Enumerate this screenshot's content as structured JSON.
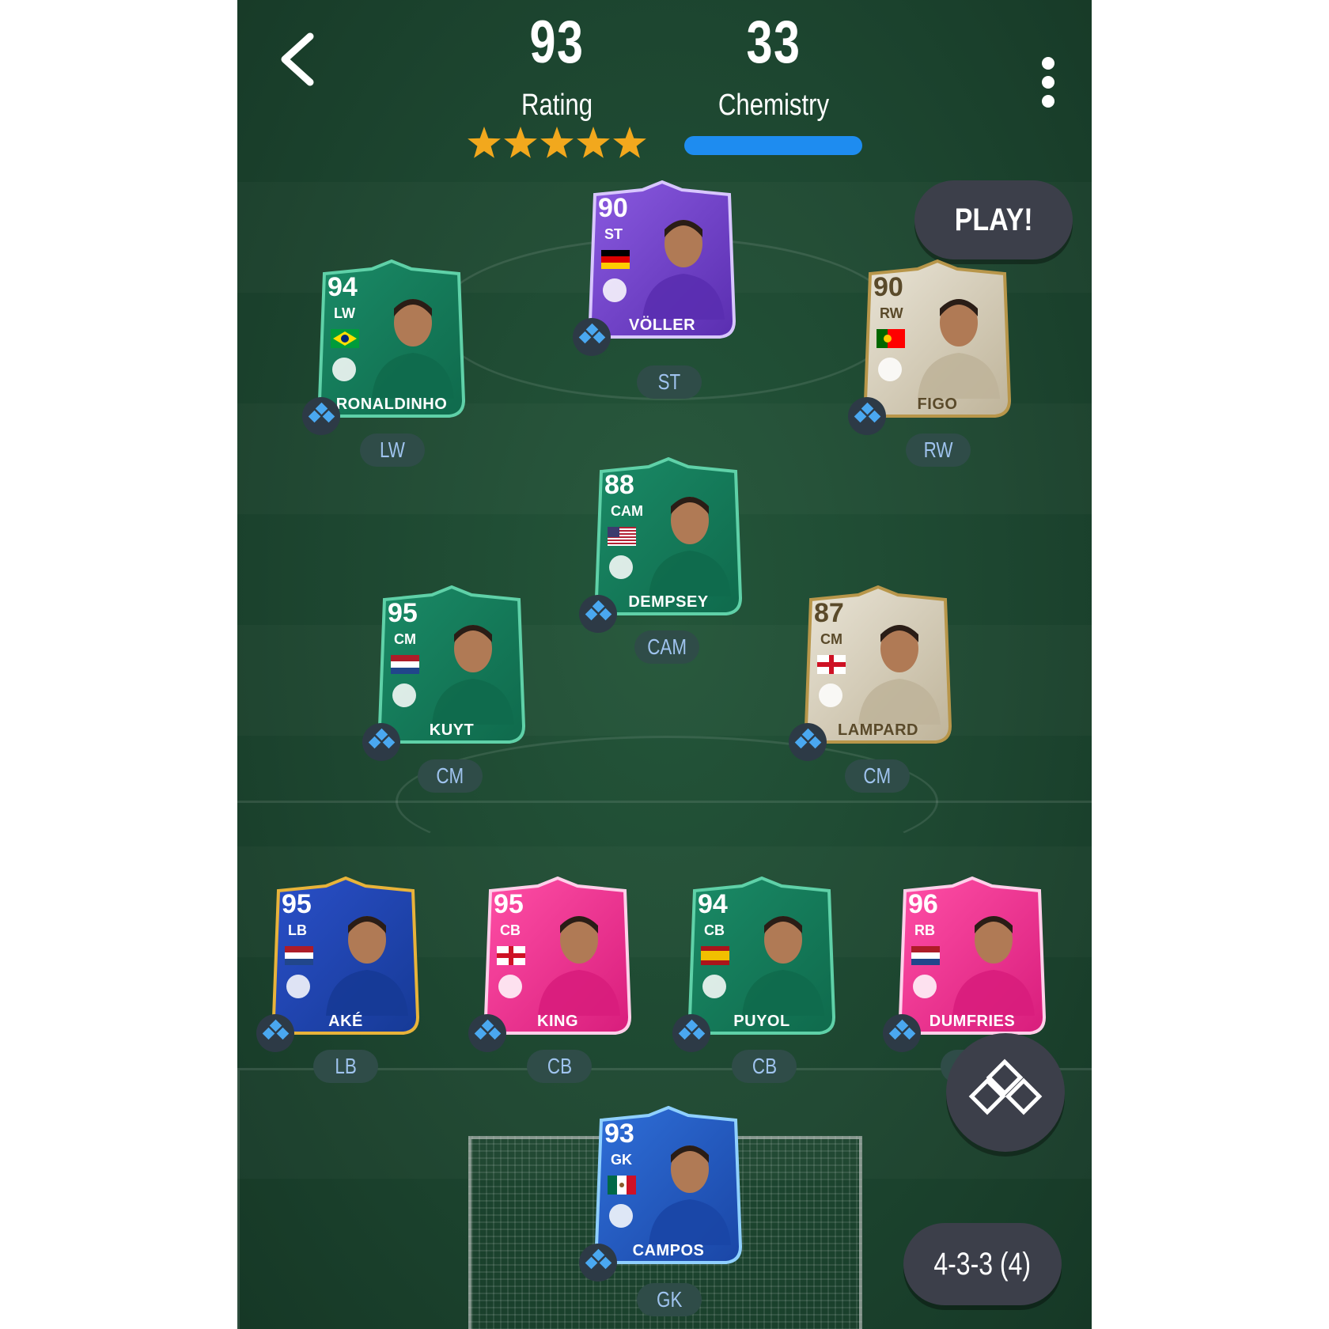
{
  "header": {
    "rating_value": "93",
    "rating_label": "Rating",
    "rating_stars": 5,
    "chemistry_value": "33",
    "chemistry_label": "Chemistry",
    "chemistry_fill": 1.0
  },
  "buttons": {
    "play_label": "PLAY!",
    "formation_label": "4-3-3 (4)"
  },
  "icons": {
    "back": "chevron-left-icon",
    "menu": "more-vertical-icon",
    "chemistry": "chemistry-diamonds-icon"
  },
  "colors": {
    "accent_blue": "#1e8cf0",
    "star": "#f2a81d",
    "pill_text": "#9fc3ee"
  },
  "players": [
    {
      "id": "st",
      "rating": "90",
      "position": "ST",
      "name": "VÖLLER",
      "slot": "ST",
      "nation": "Germany",
      "theme": "purple"
    },
    {
      "id": "lw",
      "rating": "94",
      "position": "LW",
      "name": "RONALDINHO",
      "slot": "LW",
      "nation": "Brazil",
      "theme": "green"
    },
    {
      "id": "rw",
      "rating": "90",
      "position": "RW",
      "name": "FIGO",
      "slot": "RW",
      "nation": "Portugal",
      "theme": "icon"
    },
    {
      "id": "cam",
      "rating": "88",
      "position": "CAM",
      "name": "DEMPSEY",
      "slot": "CAM",
      "nation": "USA",
      "theme": "green"
    },
    {
      "id": "lcm",
      "rating": "95",
      "position": "CM",
      "name": "KUYT",
      "slot": "CM",
      "nation": "Netherlands",
      "theme": "green"
    },
    {
      "id": "rcm",
      "rating": "87",
      "position": "CM",
      "name": "LAMPARD",
      "slot": "CM",
      "nation": "England",
      "theme": "icon"
    },
    {
      "id": "lb",
      "rating": "95",
      "position": "LB",
      "name": "AKÉ",
      "slot": "LB",
      "nation": "Netherlands",
      "theme": "euro"
    },
    {
      "id": "lcb",
      "rating": "95",
      "position": "CB",
      "name": "KING",
      "slot": "CB",
      "nation": "England",
      "theme": "pink"
    },
    {
      "id": "rcb",
      "rating": "94",
      "position": "CB",
      "name": "PUYOL",
      "slot": "CB",
      "nation": "Spain",
      "theme": "green"
    },
    {
      "id": "rb",
      "rating": "96",
      "position": "RB",
      "name": "DUMFRIES",
      "slot": "RB",
      "nation": "Netherlands",
      "theme": "pink"
    },
    {
      "id": "gk",
      "rating": "93",
      "position": "GK",
      "name": "CAMPOS",
      "slot": "GK",
      "nation": "Mexico",
      "theme": "blue"
    }
  ]
}
